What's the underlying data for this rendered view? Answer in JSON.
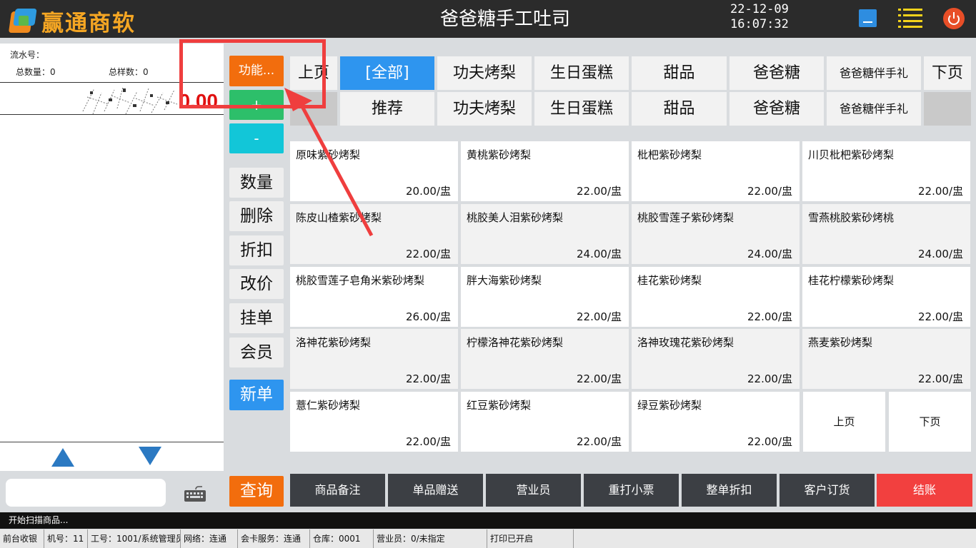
{
  "app": {
    "logo_text": "赢通商软",
    "store_title": "爸爸糖手工吐司",
    "date": "22-12-09",
    "time": "16:07:32",
    "window_buttons": [
      "minimize-icon",
      "menu-icon",
      "power-icon"
    ]
  },
  "order": {
    "serial_label": "流水号：",
    "total_qty_label": "总数量：0",
    "total_kinds_label": "总样数：0",
    "amount": "0.00",
    "scan_placeholder": ""
  },
  "functions": {
    "func": "功能...",
    "plus": "+",
    "minus": "-",
    "gray_buttons": [
      "数量",
      "删除",
      "折扣",
      "改价",
      "挂单",
      "会员"
    ],
    "new_order": "新单",
    "query": "查询"
  },
  "categories": {
    "row1": [
      "上页",
      "[全部]",
      "功夫烤梨",
      "生日蛋糕",
      "甜品",
      "爸爸糖",
      "爸爸糖伴手礼",
      "下页"
    ],
    "row2": [
      "",
      "推荐",
      "功夫烤梨",
      "生日蛋糕",
      "甜品",
      "爸爸糖",
      "爸爸糖伴手礼",
      ""
    ],
    "selected": "[全部]"
  },
  "products": [
    {
      "name": "原味紫砂烤梨",
      "price": "20.00/盅"
    },
    {
      "name": "黄桃紫砂烤梨",
      "price": "22.00/盅"
    },
    {
      "name": "枇杷紫砂烤梨",
      "price": "22.00/盅"
    },
    {
      "name": "川贝枇杷紫砂烤梨",
      "price": "22.00/盅"
    },
    {
      "name": "陈皮山楂紫砂烤梨",
      "price": "22.00/盅"
    },
    {
      "name": "桃胶美人泪紫砂烤梨",
      "price": "24.00/盅"
    },
    {
      "name": "桃胶雪莲子紫砂烤梨",
      "price": "24.00/盅"
    },
    {
      "name": "雪燕桃胶紫砂烤桃",
      "price": "24.00/盅"
    },
    {
      "name": "桃胶雪莲子皂角米紫砂烤梨",
      "price": "26.00/盅"
    },
    {
      "name": "胖大海紫砂烤梨",
      "price": "22.00/盅"
    },
    {
      "name": "桂花紫砂烤梨",
      "price": "22.00/盅"
    },
    {
      "name": "桂花柠檬紫砂烤梨",
      "price": "22.00/盅"
    },
    {
      "name": "洛神花紫砂烤梨",
      "price": "22.00/盅"
    },
    {
      "name": "柠檬洛神花紫砂烤梨",
      "price": "22.00/盅"
    },
    {
      "name": "洛神玫瑰花紫砂烤梨",
      "price": "22.00/盅"
    },
    {
      "name": "燕麦紫砂烤梨",
      "price": "22.00/盅"
    },
    {
      "name": "薏仁紫砂烤梨",
      "price": "22.00/盅"
    },
    {
      "name": "红豆紫砂烤梨",
      "price": "22.00/盅"
    },
    {
      "name": "绿豆紫砂烤梨",
      "price": "22.00/盅"
    }
  ],
  "product_pager": {
    "prev": "上页",
    "next": "下页"
  },
  "actions": [
    "商品备注",
    "单品赠送",
    "营业员",
    "重打小票",
    "整单折扣",
    "客户订货",
    "结账"
  ],
  "status_message": "开始扫描商品...",
  "statusbar": [
    "前台收银",
    "机号：11",
    "工号：1001/系统管理员",
    "网络：连通",
    "会卡服务：连通",
    "仓库：0001",
    "营业员：0/未指定",
    "打印已开启",
    ""
  ],
  "colors": {
    "topbar": "#2b2b2b",
    "accent_blue": "#2e95ef",
    "accent_orange": "#f26d0d",
    "plus_green": "#2dbf6a",
    "minus_cyan": "#12c6d8",
    "checkout_red": "#f2403f",
    "annotation_red": "#ef3e3e"
  }
}
